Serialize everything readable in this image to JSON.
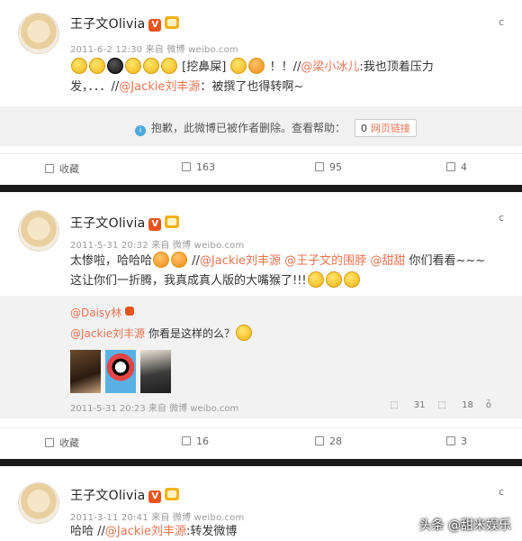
{
  "post1": {
    "author": "王子文Olivia",
    "v_badge": "V",
    "meta": "2011-6-2 12:30 来自 微博 weibo.com",
    "caret": "c",
    "text_a": "[挖鼻屎]",
    "text_b": "！！//",
    "link1": "@梁小冰儿",
    "text_c": ":我也顶着压力发，．．．//",
    "link2": "@Jackie刘丰源",
    "text_d": "：被撰了也得转啊~",
    "deleted_notice": "抱歉，此微博已被作者删除。查看帮助：",
    "report_count": "0",
    "report_label": "网页链接",
    "actions": {
      "favorite": "收藏",
      "repost": "163",
      "comment": "95",
      "like": "4"
    }
  },
  "post2": {
    "author": "王子文Olivia",
    "v_badge": "V",
    "meta": "2011-5-31 20:32 来自 微博 weibo.com",
    "caret": "c",
    "text_a": "太惨啦，哈哈哈",
    "text_b": " //",
    "link1": "@Jackie刘丰源",
    "text_c": " ",
    "link2": "@王子文的围脖",
    "text_d": " ",
    "link3": "@甜甜",
    "text_e": " 你们看看~~~这让你们一折腾，我真成真人版的大嘴猴了!!!",
    "repost": {
      "user": "@Daisy林",
      "link": "@Jackie刘丰源",
      "text": " 你看是这样的么？",
      "meta": "2011-5-31 20:23 来自 微博 weibo.com",
      "stats": {
        "repost": "31",
        "comment": "18",
        "like": ""
      }
    },
    "actions": {
      "favorite": "收藏",
      "repost": "16",
      "comment": "28",
      "like": "3"
    }
  },
  "post3": {
    "author": "王子文Olivia",
    "v_badge": "V",
    "meta": "2011-3-11 20:41 来自 微博 weibo.com",
    "caret": "c",
    "text_a": "哈哈 //",
    "link1": "@Jackie刘丰源",
    "text_b": ":转发微博"
  },
  "watermark": "头条 @甜米娱乐",
  "colors": {
    "link": "#eb7350",
    "divider": "#1a1a1a",
    "badge": "#e8541e"
  }
}
